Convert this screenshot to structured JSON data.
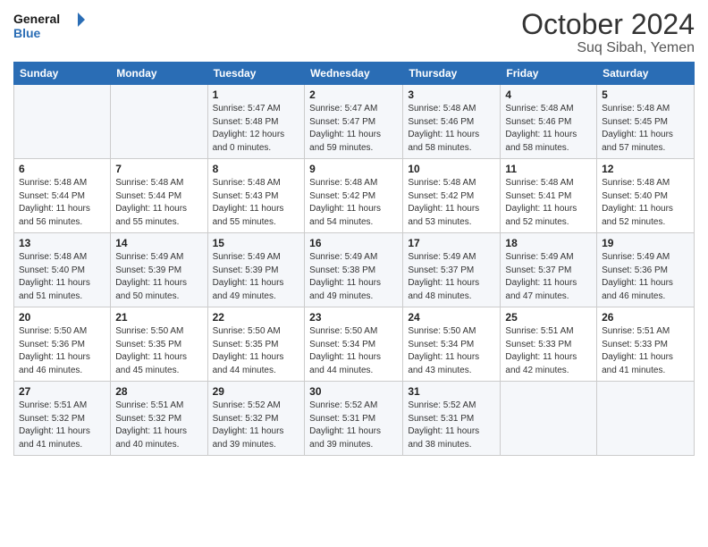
{
  "header": {
    "logo_line1": "General",
    "logo_line2": "Blue",
    "month_title": "October 2024",
    "location": "Suq Sibah, Yemen"
  },
  "days_of_week": [
    "Sunday",
    "Monday",
    "Tuesday",
    "Wednesday",
    "Thursday",
    "Friday",
    "Saturday"
  ],
  "weeks": [
    [
      {
        "day": "",
        "sunrise": "",
        "sunset": "",
        "daylight": ""
      },
      {
        "day": "",
        "sunrise": "",
        "sunset": "",
        "daylight": ""
      },
      {
        "day": "1",
        "sunrise": "Sunrise: 5:47 AM",
        "sunset": "Sunset: 5:48 PM",
        "daylight": "Daylight: 12 hours and 0 minutes."
      },
      {
        "day": "2",
        "sunrise": "Sunrise: 5:47 AM",
        "sunset": "Sunset: 5:47 PM",
        "daylight": "Daylight: 11 hours and 59 minutes."
      },
      {
        "day": "3",
        "sunrise": "Sunrise: 5:48 AM",
        "sunset": "Sunset: 5:46 PM",
        "daylight": "Daylight: 11 hours and 58 minutes."
      },
      {
        "day": "4",
        "sunrise": "Sunrise: 5:48 AM",
        "sunset": "Sunset: 5:46 PM",
        "daylight": "Daylight: 11 hours and 58 minutes."
      },
      {
        "day": "5",
        "sunrise": "Sunrise: 5:48 AM",
        "sunset": "Sunset: 5:45 PM",
        "daylight": "Daylight: 11 hours and 57 minutes."
      }
    ],
    [
      {
        "day": "6",
        "sunrise": "Sunrise: 5:48 AM",
        "sunset": "Sunset: 5:44 PM",
        "daylight": "Daylight: 11 hours and 56 minutes."
      },
      {
        "day": "7",
        "sunrise": "Sunrise: 5:48 AM",
        "sunset": "Sunset: 5:44 PM",
        "daylight": "Daylight: 11 hours and 55 minutes."
      },
      {
        "day": "8",
        "sunrise": "Sunrise: 5:48 AM",
        "sunset": "Sunset: 5:43 PM",
        "daylight": "Daylight: 11 hours and 55 minutes."
      },
      {
        "day": "9",
        "sunrise": "Sunrise: 5:48 AM",
        "sunset": "Sunset: 5:42 PM",
        "daylight": "Daylight: 11 hours and 54 minutes."
      },
      {
        "day": "10",
        "sunrise": "Sunrise: 5:48 AM",
        "sunset": "Sunset: 5:42 PM",
        "daylight": "Daylight: 11 hours and 53 minutes."
      },
      {
        "day": "11",
        "sunrise": "Sunrise: 5:48 AM",
        "sunset": "Sunset: 5:41 PM",
        "daylight": "Daylight: 11 hours and 52 minutes."
      },
      {
        "day": "12",
        "sunrise": "Sunrise: 5:48 AM",
        "sunset": "Sunset: 5:40 PM",
        "daylight": "Daylight: 11 hours and 52 minutes."
      }
    ],
    [
      {
        "day": "13",
        "sunrise": "Sunrise: 5:48 AM",
        "sunset": "Sunset: 5:40 PM",
        "daylight": "Daylight: 11 hours and 51 minutes."
      },
      {
        "day": "14",
        "sunrise": "Sunrise: 5:49 AM",
        "sunset": "Sunset: 5:39 PM",
        "daylight": "Daylight: 11 hours and 50 minutes."
      },
      {
        "day": "15",
        "sunrise": "Sunrise: 5:49 AM",
        "sunset": "Sunset: 5:39 PM",
        "daylight": "Daylight: 11 hours and 49 minutes."
      },
      {
        "day": "16",
        "sunrise": "Sunrise: 5:49 AM",
        "sunset": "Sunset: 5:38 PM",
        "daylight": "Daylight: 11 hours and 49 minutes."
      },
      {
        "day": "17",
        "sunrise": "Sunrise: 5:49 AM",
        "sunset": "Sunset: 5:37 PM",
        "daylight": "Daylight: 11 hours and 48 minutes."
      },
      {
        "day": "18",
        "sunrise": "Sunrise: 5:49 AM",
        "sunset": "Sunset: 5:37 PM",
        "daylight": "Daylight: 11 hours and 47 minutes."
      },
      {
        "day": "19",
        "sunrise": "Sunrise: 5:49 AM",
        "sunset": "Sunset: 5:36 PM",
        "daylight": "Daylight: 11 hours and 46 minutes."
      }
    ],
    [
      {
        "day": "20",
        "sunrise": "Sunrise: 5:50 AM",
        "sunset": "Sunset: 5:36 PM",
        "daylight": "Daylight: 11 hours and 46 minutes."
      },
      {
        "day": "21",
        "sunrise": "Sunrise: 5:50 AM",
        "sunset": "Sunset: 5:35 PM",
        "daylight": "Daylight: 11 hours and 45 minutes."
      },
      {
        "day": "22",
        "sunrise": "Sunrise: 5:50 AM",
        "sunset": "Sunset: 5:35 PM",
        "daylight": "Daylight: 11 hours and 44 minutes."
      },
      {
        "day": "23",
        "sunrise": "Sunrise: 5:50 AM",
        "sunset": "Sunset: 5:34 PM",
        "daylight": "Daylight: 11 hours and 44 minutes."
      },
      {
        "day": "24",
        "sunrise": "Sunrise: 5:50 AM",
        "sunset": "Sunset: 5:34 PM",
        "daylight": "Daylight: 11 hours and 43 minutes."
      },
      {
        "day": "25",
        "sunrise": "Sunrise: 5:51 AM",
        "sunset": "Sunset: 5:33 PM",
        "daylight": "Daylight: 11 hours and 42 minutes."
      },
      {
        "day": "26",
        "sunrise": "Sunrise: 5:51 AM",
        "sunset": "Sunset: 5:33 PM",
        "daylight": "Daylight: 11 hours and 41 minutes."
      }
    ],
    [
      {
        "day": "27",
        "sunrise": "Sunrise: 5:51 AM",
        "sunset": "Sunset: 5:32 PM",
        "daylight": "Daylight: 11 hours and 41 minutes."
      },
      {
        "day": "28",
        "sunrise": "Sunrise: 5:51 AM",
        "sunset": "Sunset: 5:32 PM",
        "daylight": "Daylight: 11 hours and 40 minutes."
      },
      {
        "day": "29",
        "sunrise": "Sunrise: 5:52 AM",
        "sunset": "Sunset: 5:32 PM",
        "daylight": "Daylight: 11 hours and 39 minutes."
      },
      {
        "day": "30",
        "sunrise": "Sunrise: 5:52 AM",
        "sunset": "Sunset: 5:31 PM",
        "daylight": "Daylight: 11 hours and 39 minutes."
      },
      {
        "day": "31",
        "sunrise": "Sunrise: 5:52 AM",
        "sunset": "Sunset: 5:31 PM",
        "daylight": "Daylight: 11 hours and 38 minutes."
      },
      {
        "day": "",
        "sunrise": "",
        "sunset": "",
        "daylight": ""
      },
      {
        "day": "",
        "sunrise": "",
        "sunset": "",
        "daylight": ""
      }
    ]
  ]
}
